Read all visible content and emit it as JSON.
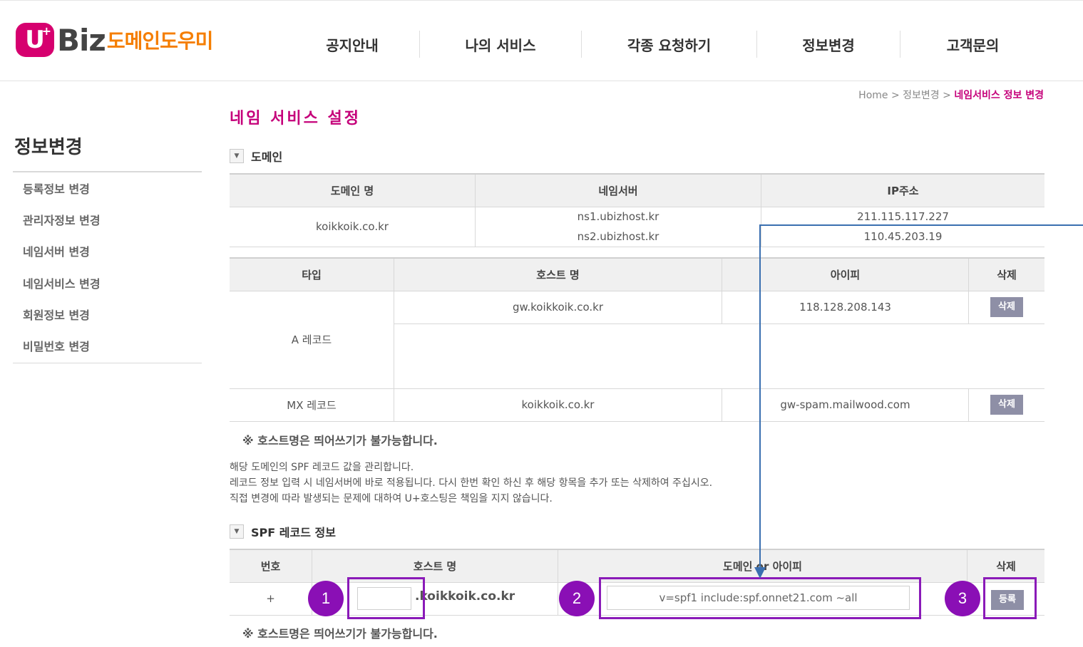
{
  "logo": {
    "u": "U",
    "plus": "+",
    "biz": "Biz",
    "kr": "도메인도우미"
  },
  "gnb": [
    "공지안내",
    "나의 서비스",
    "각종 요청하기",
    "정보변경",
    "고객문의"
  ],
  "breadcrumb": {
    "home": "Home",
    "sep1": ">",
    "mid": "정보변경",
    "sep2": ">",
    "current": "네임서비스 정보 변경"
  },
  "page_title": "네임 서비스 설정",
  "sidebar": {
    "title": "정보변경",
    "items": [
      "등록정보 변경",
      "관리자정보 변경",
      "네임서버 변경",
      "네임서비스 변경",
      "회원정보 변경",
      "비밀번호 변경"
    ]
  },
  "domain_section": {
    "title": "도메인",
    "headers": [
      "도메인 명",
      "네임서버",
      "IP주소"
    ],
    "domain": "koikkoik.co.kr",
    "ns": [
      "ns1.ubizhost.kr",
      "ns2.ubizhost.kr"
    ],
    "ips": [
      "211.115.117.227",
      "110.45.203.19"
    ]
  },
  "records": {
    "headers": [
      "타입",
      "호스트 명",
      "아이피",
      "삭제"
    ],
    "a_label": "A 레코드",
    "a_host": "gw.koikkoik.co.kr",
    "a_ip": "118.128.208.143",
    "mx_label": "MX 레코드",
    "mx_host": "koikkoik.co.kr",
    "mx_ip": "gw-spam.mailwood.com",
    "delete": "삭제"
  },
  "note": "※ 호스트명은 띄어쓰기가 불가능합니다.",
  "desc": [
    "해당 도메인의 SPF 레코드 값을 관리합니다.",
    "레코드 정보 입력 시 네임서버에 바로 적용됩니다. 다시 한번 확인 하신 후 해당 항목을 추가 또는 삭제하여 주십시오.",
    "직접 변경에 따라 발생되는 문제에 대하여 U+호스팅은 책임을 지지 않습니다."
  ],
  "spf": {
    "title": "SPF 레코드 정보",
    "headers": [
      "번호",
      "호스트 명",
      "도메인 or 아이피",
      "삭제"
    ],
    "row_no": "+",
    "host_value": "",
    "host_suffix": ".koikkoik.co.kr",
    "value": "v=spf1 include:spf.onnet21.com ~all",
    "register": "등록"
  },
  "note2": "※ 호스트명은 띄어쓰기가 불가능합니다.",
  "annotations": [
    "1",
    "2",
    "3"
  ],
  "colors": {
    "accent": "#c5007a",
    "highlight": "#8a1ab8",
    "arrow": "#3a6fb0"
  }
}
